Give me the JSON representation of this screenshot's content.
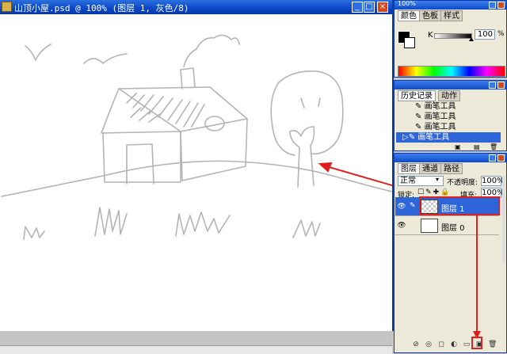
{
  "document": {
    "title": "山顶小屋.psd @ 100% (图层 1, 灰色/8)",
    "top_partial": "100%"
  },
  "color_panel": {
    "tabs": [
      "颜色",
      "色板",
      "样式"
    ],
    "channel_label": "K",
    "value": "100",
    "unit": "%"
  },
  "history_panel": {
    "tabs": [
      "历史记录",
      "动作"
    ],
    "items": [
      "画笔工具",
      "画笔工具",
      "画笔工具",
      "画笔工具"
    ],
    "selected_index": 3
  },
  "layers_panel": {
    "tabs": [
      "图层",
      "通道",
      "路径"
    ],
    "blend_mode": "正常",
    "opacity_label": "不透明度:",
    "opacity_value": "100%",
    "lock_label": "锁定:",
    "fill_label": "填充:",
    "fill_value": "100%",
    "layers": [
      {
        "name": "图层 1",
        "selected": true,
        "transparent": true
      },
      {
        "name": "图层 0",
        "selected": false,
        "transparent": false
      }
    ]
  },
  "colors": {
    "annotation": "#e02020",
    "title_blue": "#0a46c6",
    "selection": "#2e66d9"
  }
}
